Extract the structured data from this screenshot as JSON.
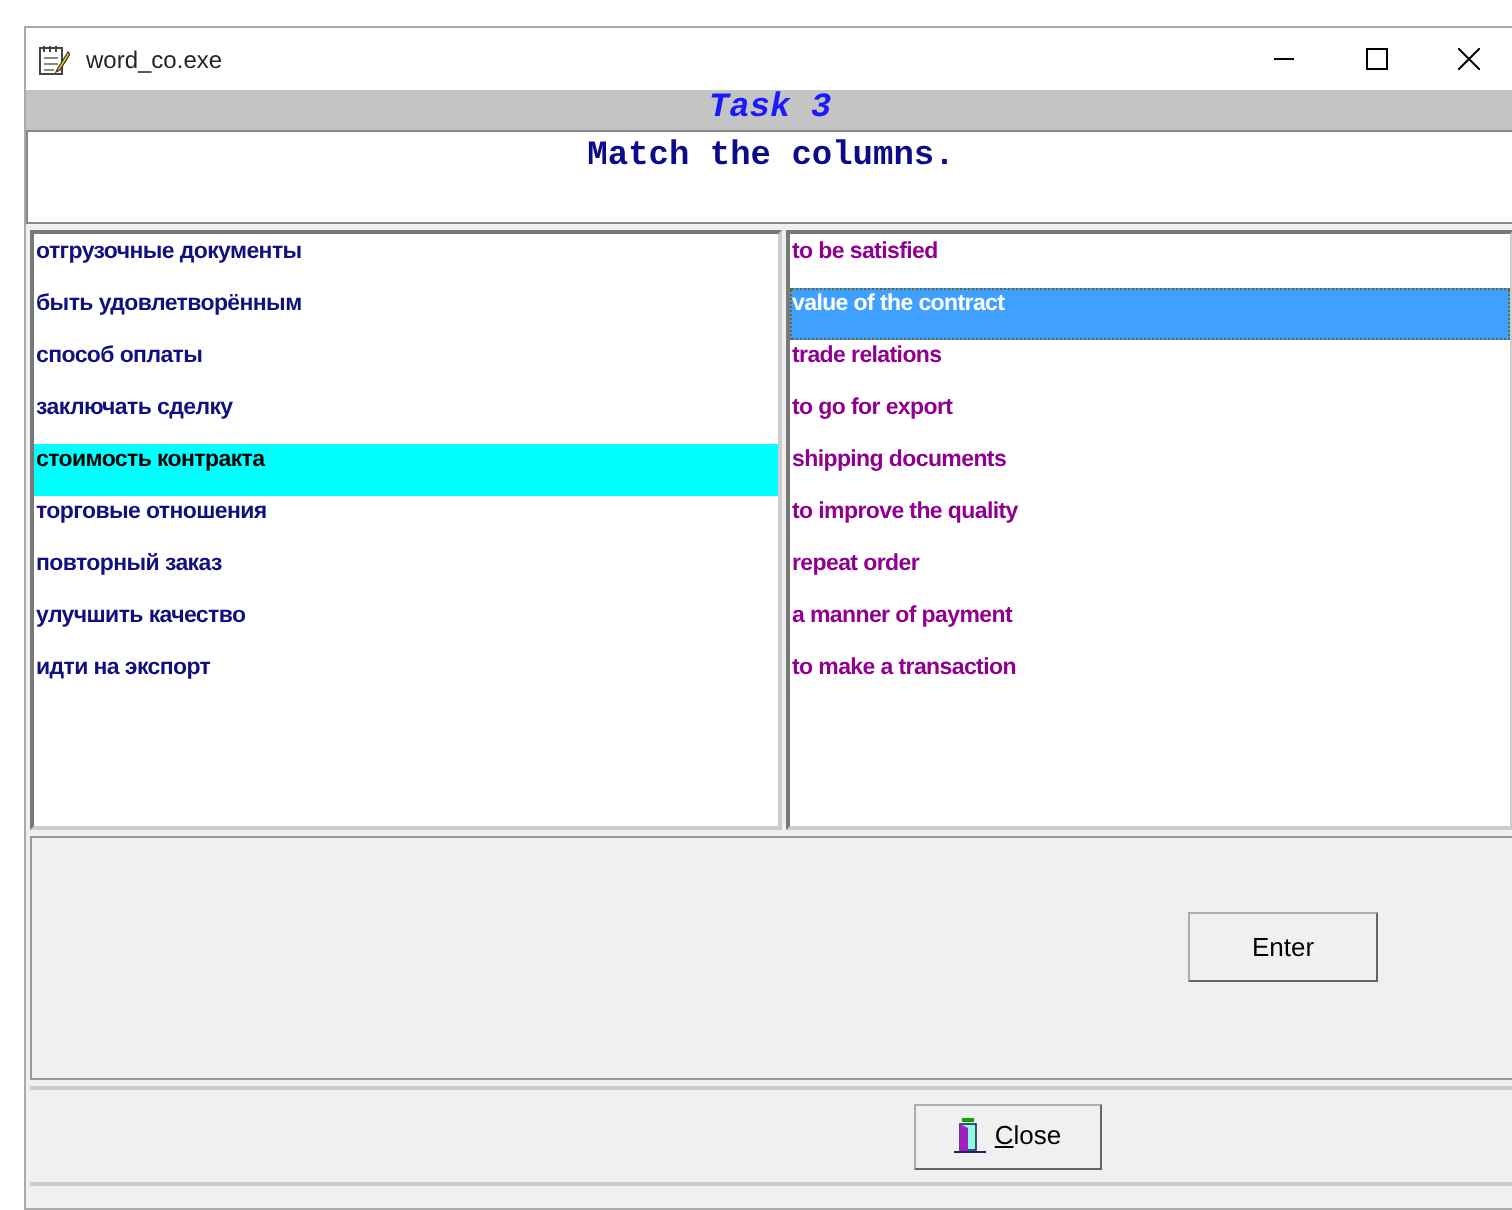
{
  "window": {
    "title": "word_co.exe"
  },
  "task_title": "Task 3",
  "instruction": "Match the columns.",
  "left_list": [
    {
      "text": "отгрузочные документы",
      "selected": false
    },
    {
      "text": "быть удовлетворённым",
      "selected": false
    },
    {
      "text": "способ оплаты",
      "selected": false
    },
    {
      "text": "заключать сделку",
      "selected": false
    },
    {
      "text": "стоимость контракта",
      "selected": true
    },
    {
      "text": "торговые отношения",
      "selected": false
    },
    {
      "text": "повторный заказ",
      "selected": false
    },
    {
      "text": "улучшить качество",
      "selected": false
    },
    {
      "text": "идти на экспорт",
      "selected": false
    }
  ],
  "right_list": [
    {
      "text": "to be satisfied",
      "selected": false
    },
    {
      "text": "value of the contract",
      "selected": true
    },
    {
      "text": "trade relations",
      "selected": false
    },
    {
      "text": "to go for export",
      "selected": false
    },
    {
      "text": "shipping documents",
      "selected": false
    },
    {
      "text": "to improve the quality",
      "selected": false
    },
    {
      "text": "repeat order",
      "selected": false
    },
    {
      "text": "a manner of payment",
      "selected": false
    },
    {
      "text": "to make a transaction",
      "selected": false
    }
  ],
  "buttons": {
    "enter": "Enter",
    "close": "Close"
  }
}
